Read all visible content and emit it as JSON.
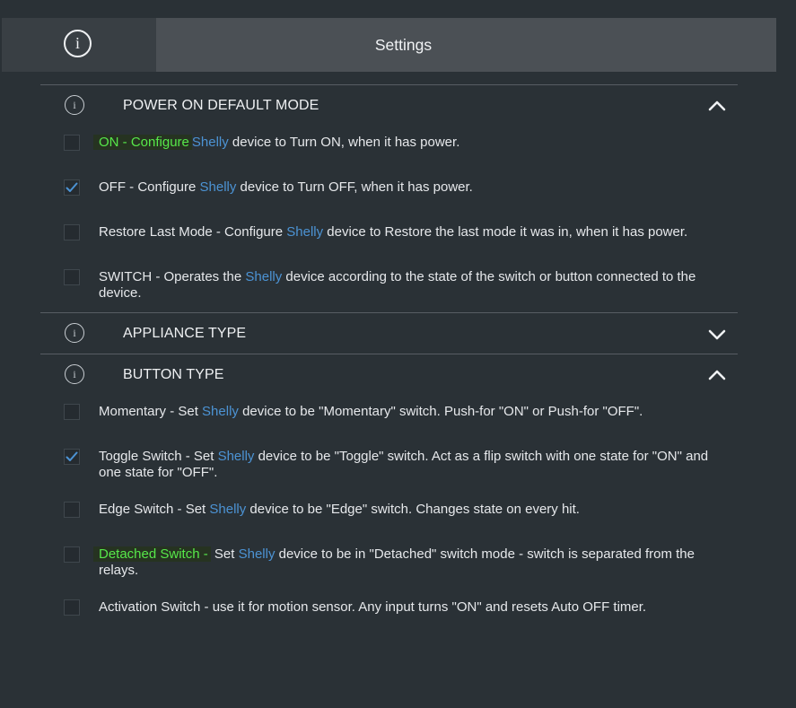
{
  "header": {
    "title": "Settings",
    "info_icon": "info-icon"
  },
  "colors": {
    "accent": "#4c93d4",
    "highlight": "#57e84a",
    "background": "#2a3136"
  },
  "sections": [
    {
      "title": "POWER ON DEFAULT MODE",
      "expanded": true,
      "options": [
        {
          "highlight": "ON - Configure",
          "brand": "Shelly",
          "before": "",
          "after": " device to Turn ON, when it has power.",
          "checked": false
        },
        {
          "highlight": "",
          "before": "OFF - Configure ",
          "brand": "Shelly",
          "after": " device to Turn OFF, when it has power.",
          "checked": true
        },
        {
          "highlight": "",
          "before": "Restore Last Mode - Configure ",
          "brand": "Shelly",
          "after": " device to Restore the last mode it was in, when it has power.",
          "checked": false
        },
        {
          "highlight": "",
          "before": "SWITCH - Operates the ",
          "brand": "Shelly",
          "after": " device according to the state of the switch or button connected to the device.",
          "checked": false
        }
      ]
    },
    {
      "title": "APPLIANCE TYPE",
      "expanded": false,
      "options": []
    },
    {
      "title": "BUTTON TYPE",
      "expanded": true,
      "options": [
        {
          "highlight": "",
          "before": "Momentary - Set ",
          "brand": "Shelly",
          "after": " device to be \"Momentary\" switch. Push-for \"ON\" or Push-for \"OFF\".",
          "checked": false
        },
        {
          "highlight": "",
          "before": "Toggle Switch - Set ",
          "brand": "Shelly",
          "after": " device to be \"Toggle\" switch. Act as a flip switch with one state for \"ON\" and one state for \"OFF\".",
          "checked": true
        },
        {
          "highlight": "",
          "before": "Edge Switch - Set ",
          "brand": "Shelly",
          "after": " device to be \"Edge\" switch. Changes state on every hit.",
          "checked": false
        },
        {
          "highlight": "Detached Switch -",
          "before": "",
          "brand": "Shelly",
          "after": " device to be in \"Detached\" switch mode - switch is separated from the relays.",
          "pre_brand": " Set ",
          "checked": false
        },
        {
          "highlight": "",
          "before": "Activation Switch - use it for motion sensor. Any input turns \"ON\" and resets Auto OFF timer.",
          "brand": "",
          "after": "",
          "checked": false
        }
      ]
    }
  ]
}
